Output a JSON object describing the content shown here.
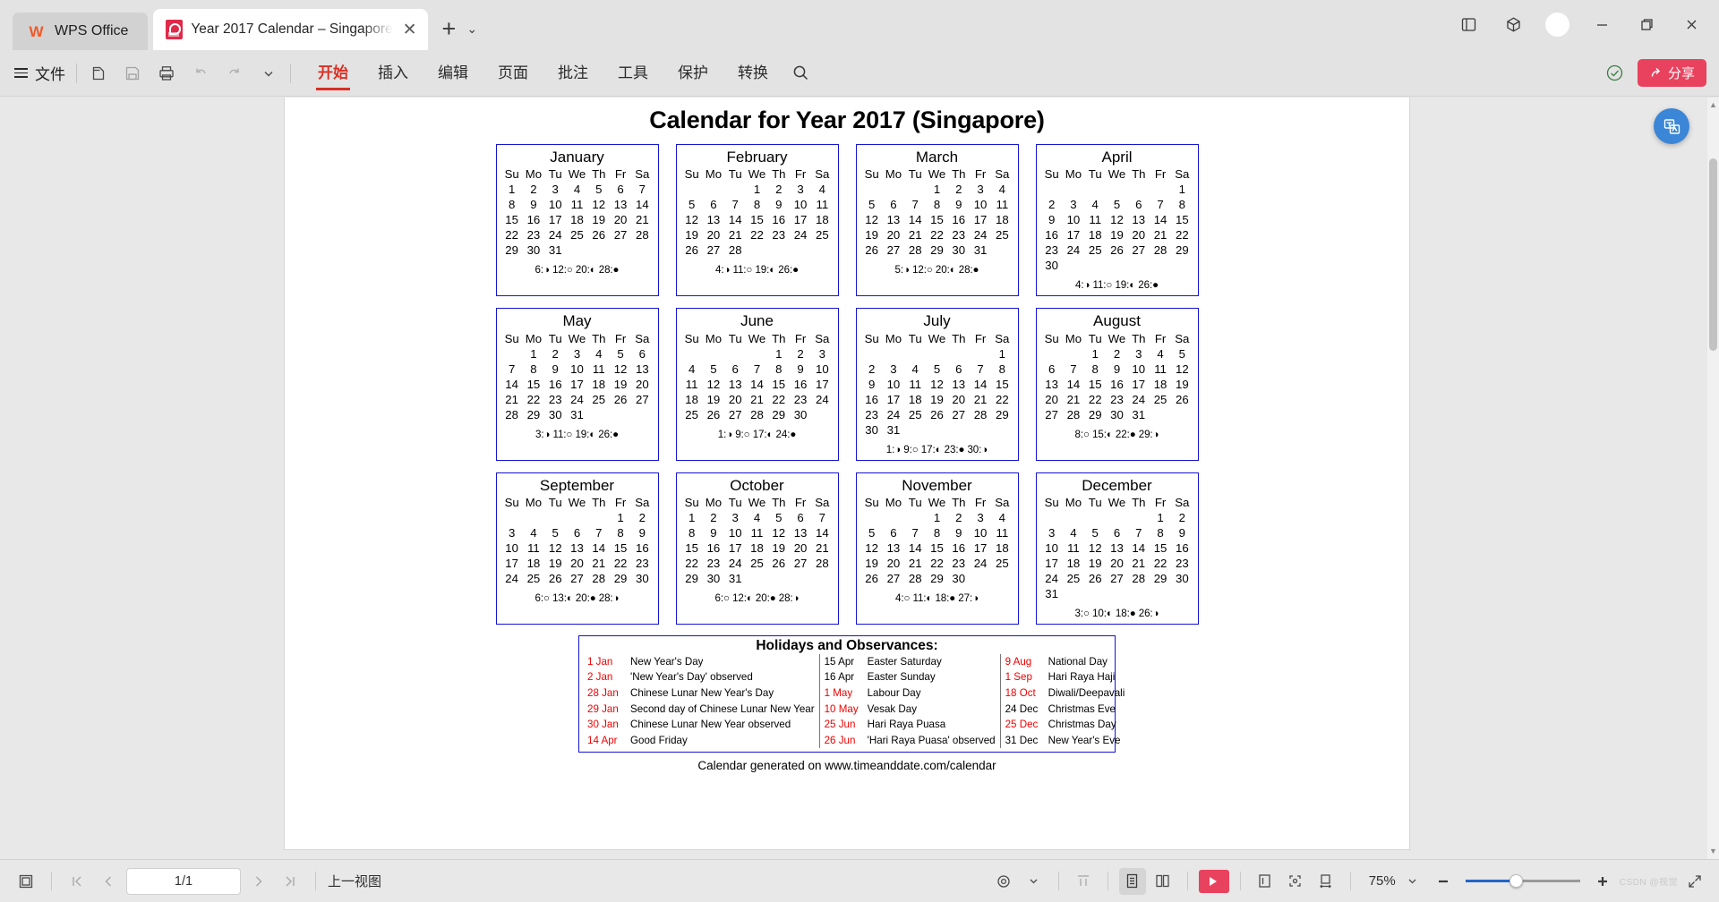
{
  "titlebar": {
    "app_name": "WPS Office",
    "app_logo_glyph": "W",
    "tab_title": "Year 2017 Calendar – Singapore",
    "tab_close_glyph": "✕",
    "new_tab_glyph": "+",
    "new_tab_chevron": "⌄"
  },
  "ribbon": {
    "file_label": "文件",
    "tabs": [
      {
        "label": "开始",
        "active": true
      },
      {
        "label": "插入",
        "active": false
      },
      {
        "label": "编辑",
        "active": false
      },
      {
        "label": "页面",
        "active": false
      },
      {
        "label": "批注",
        "active": false
      },
      {
        "label": "工具",
        "active": false
      },
      {
        "label": "保护",
        "active": false
      },
      {
        "label": "转换",
        "active": false
      }
    ],
    "share_label": "分享",
    "share_color": "#e8425e",
    "active_tab_color": "#d93025"
  },
  "document": {
    "title": "Calendar for Year 2017 (Singapore)",
    "generated_line": "Calendar generated on www.timeanddate.com/calendar",
    "border_color": "#1414d6",
    "sunday_color": "#ee0000",
    "saturday_color": "#7b7b7b",
    "weekday_headers": [
      "Su",
      "Mo",
      "Tu",
      "We",
      "Th",
      "Fr",
      "Sa"
    ],
    "months": [
      {
        "name": "January",
        "lead_blanks": 0,
        "days": 31,
        "holidays": [
          1,
          2,
          28,
          29,
          30
        ],
        "moons": "6:◑ 12:○ 20:◐ 28:●"
      },
      {
        "name": "February",
        "lead_blanks": 3,
        "days": 28,
        "holidays": [],
        "moons": "4:◑ 11:○ 19:◐ 26:●"
      },
      {
        "name": "March",
        "lead_blanks": 3,
        "days": 31,
        "holidays": [],
        "moons": "5:◑ 12:○ 20:◐ 28:●"
      },
      {
        "name": "April",
        "lead_blanks": 6,
        "days": 30,
        "holidays": [
          14,
          16
        ],
        "moons": "4:◑ 11:○ 19:◐ 26:●"
      },
      {
        "name": "May",
        "lead_blanks": 1,
        "days": 31,
        "holidays": [
          1,
          10
        ],
        "moons": "3:◑ 11:○ 19:◐ 26:●"
      },
      {
        "name": "June",
        "lead_blanks": 4,
        "days": 30,
        "holidays": [
          26
        ],
        "moons": "1:◑ 9:○ 17:◐ 24:●"
      },
      {
        "name": "July",
        "lead_blanks": 6,
        "days": 31,
        "holidays": [],
        "moons": "1:◑ 9:○ 17:◐ 23:● 30:◑"
      },
      {
        "name": "August",
        "lead_blanks": 2,
        "days": 31,
        "holidays": [
          9
        ],
        "moons": "8:○ 15:◐ 22:● 29:◑"
      },
      {
        "name": "September",
        "lead_blanks": 5,
        "days": 30,
        "holidays": [
          1
        ],
        "moons": "6:○ 13:◐ 20:● 28:◑"
      },
      {
        "name": "October",
        "lead_blanks": 0,
        "days": 31,
        "holidays": [
          18
        ],
        "moons": "6:○ 12:◐ 20:● 28:◑"
      },
      {
        "name": "November",
        "lead_blanks": 3,
        "days": 30,
        "holidays": [],
        "moons": "4:○ 11:◐ 18:● 27:◑"
      },
      {
        "name": "December",
        "lead_blanks": 5,
        "days": 31,
        "holidays": [
          25
        ],
        "moons": "3:○ 10:◐ 18:● 26:◑"
      }
    ],
    "holidays_section": {
      "title": "Holidays and Observances:",
      "columns": [
        [
          {
            "date": "1 Jan",
            "red": true,
            "name": "New Year's Day"
          },
          {
            "date": "2 Jan",
            "red": true,
            "name": "'New Year's Day' observed"
          },
          {
            "date": "28 Jan",
            "red": true,
            "name": "Chinese Lunar New Year's Day"
          },
          {
            "date": "29 Jan",
            "red": true,
            "name": "Second day of Chinese Lunar New Year"
          },
          {
            "date": "30 Jan",
            "red": true,
            "name": "Chinese Lunar New Year observed"
          },
          {
            "date": "14 Apr",
            "red": true,
            "name": "Good Friday"
          }
        ],
        [
          {
            "date": "15 Apr",
            "red": false,
            "name": "Easter Saturday"
          },
          {
            "date": "16 Apr",
            "red": false,
            "name": "Easter Sunday"
          },
          {
            "date": "1 May",
            "red": true,
            "name": "Labour Day"
          },
          {
            "date": "10 May",
            "red": true,
            "name": "Vesak Day"
          },
          {
            "date": "25 Jun",
            "red": true,
            "name": "Hari Raya Puasa"
          },
          {
            "date": "26 Jun",
            "red": true,
            "name": "'Hari Raya Puasa' observed"
          }
        ],
        [
          {
            "date": "9 Aug",
            "red": true,
            "name": "National Day"
          },
          {
            "date": "1 Sep",
            "red": true,
            "name": "Hari Raya Haji"
          },
          {
            "date": "18 Oct",
            "red": true,
            "name": "Diwali/Deepavali"
          },
          {
            "date": "24 Dec",
            "red": false,
            "name": "Christmas Eve"
          },
          {
            "date": "25 Dec",
            "red": true,
            "name": "Christmas Day"
          },
          {
            "date": "31 Dec",
            "red": false,
            "name": "New Year's Eve"
          }
        ]
      ]
    }
  },
  "statusbar": {
    "page_indicator": "1/1",
    "view_label": "上一视图",
    "zoom_level": "75%",
    "zoom_chevron": "⌄",
    "watermark": "CSDN @视觉"
  }
}
